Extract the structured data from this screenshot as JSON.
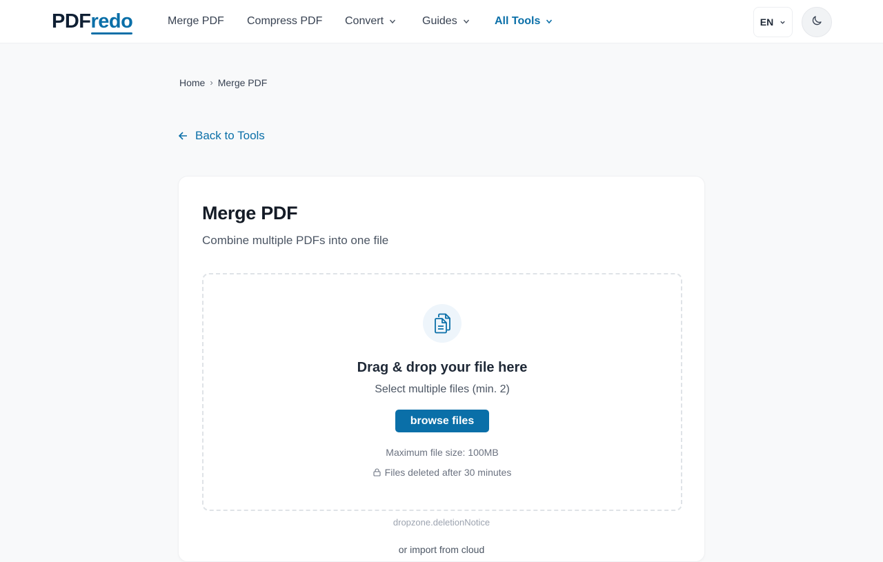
{
  "header": {
    "logo_part1": "PDF",
    "logo_part2": "redo",
    "nav": {
      "merge": "Merge PDF",
      "compress": "Compress PDF",
      "convert": "Convert",
      "guides": "Guides",
      "all_tools": "All Tools"
    },
    "language": "EN",
    "theme_icon": "moon-icon"
  },
  "breadcrumb": {
    "home": "Home",
    "separator": "›",
    "current": "Merge PDF"
  },
  "back_link": "Back to Tools",
  "tool": {
    "title": "Merge PDF",
    "subtitle": "Combine multiple PDFs into one file"
  },
  "dropzone": {
    "icon": "files-icon",
    "title": "Drag & drop your file here",
    "subtitle": "Select multiple files (min. 2)",
    "browse_label": "browse files",
    "max_size": "Maximum file size: 100MB",
    "deleted_note": "Files deleted after 30 minutes"
  },
  "deletion_notice": "dropzone.deletionNotice",
  "cloud_import": "or import from cloud",
  "colors": {
    "accent": "#0a6fa8",
    "background": "#f8f9fa",
    "logo_dark": "#0f1f33"
  }
}
